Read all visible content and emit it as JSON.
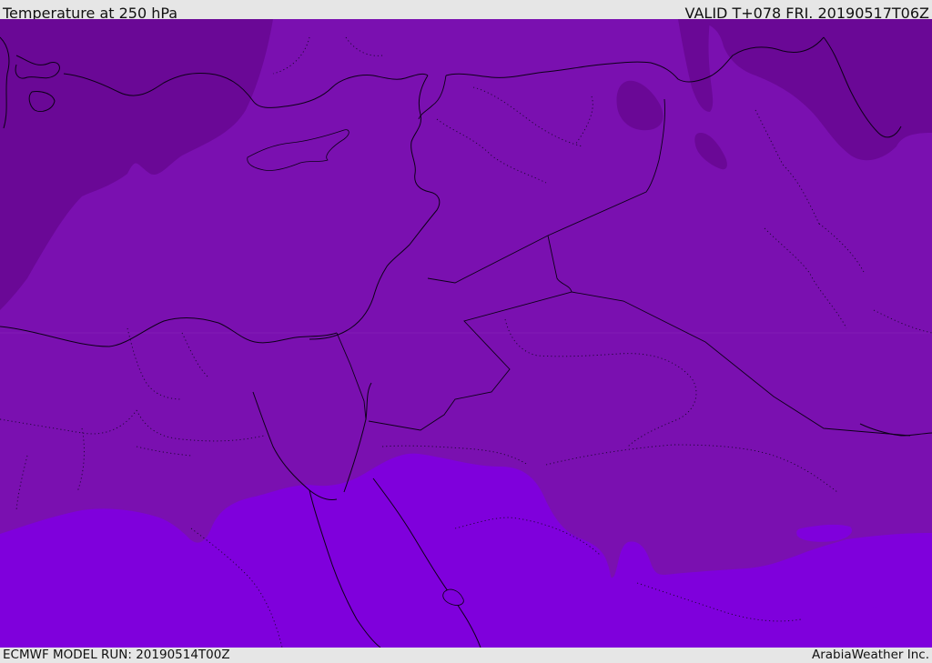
{
  "header": {
    "title": "Temperature at 250 hPa",
    "valid": "VALID T+078 FRI. 20190517T06Z"
  },
  "footer": {
    "model_run": "ECMWF MODEL RUN: 20190514T00Z",
    "credit": "ArabiaWeather Inc."
  },
  "colors": {
    "cold_band": "#6a0896",
    "mid_band": "#7a10b0",
    "warm_band": "#7f00dc",
    "boundary": "#0d0018"
  }
}
